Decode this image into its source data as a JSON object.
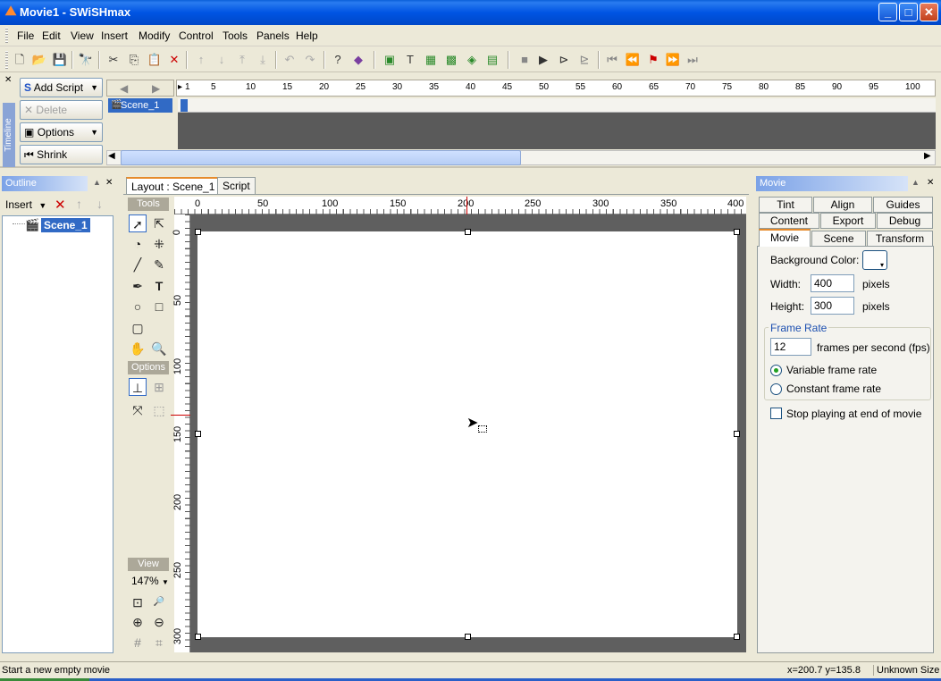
{
  "window": {
    "title": "Movie1 - SWiSHmax",
    "minimize": "_",
    "maximize": "□",
    "close": "✕"
  },
  "menu": [
    "File",
    "Edit",
    "View",
    "Insert",
    "Modify",
    "Control",
    "Tools",
    "Panels",
    "Help"
  ],
  "timeline": {
    "add_script": "Add Script",
    "delete": "Delete",
    "options": "Options",
    "shrink": "Shrink",
    "side_label": "Timeline",
    "scene": "Scene_1",
    "frame_ticks": [
      "1",
      "5",
      "10",
      "15",
      "20",
      "25",
      "30",
      "35",
      "40",
      "45",
      "50",
      "55",
      "60",
      "65",
      "70",
      "75",
      "80",
      "85",
      "90",
      "95",
      "100"
    ]
  },
  "outline": {
    "title": "Outline",
    "insert": "Insert",
    "tree_item": "Scene_1"
  },
  "layout": {
    "tab_active": "Layout : Scene_1",
    "tab_script": "Script",
    "tools_header": "Tools",
    "options_header": "Options",
    "view_header": "View",
    "zoom": "147%",
    "h_ticks": [
      "0",
      "50",
      "100",
      "150",
      "200",
      "250",
      "300",
      "350",
      "400"
    ],
    "v_ticks": [
      "0",
      "50",
      "100",
      "150",
      "200",
      "250",
      "300"
    ]
  },
  "movie_panel": {
    "title": "Movie",
    "tabs_row1": [
      "Tint",
      "Align",
      "Guides"
    ],
    "tabs_row2": [
      "Content",
      "Export",
      "Debug"
    ],
    "tabs_row3": [
      "Movie",
      "Scene",
      "Transform"
    ],
    "bg_color_label": "Background Color:",
    "width_label": "Width:",
    "width_value": "400",
    "height_label": "Height:",
    "height_value": "300",
    "pixels": "pixels",
    "frame_rate_group": "Frame Rate",
    "fps_value": "12",
    "fps_label": "frames per second (fps)",
    "variable_rate": "Variable frame rate",
    "constant_rate": "Constant frame rate",
    "stop_playing": "Stop playing at end of movie"
  },
  "status": {
    "message": "Start a new empty movie",
    "coords": "x=200.7 y=135.8",
    "size": "Unknown Size"
  }
}
